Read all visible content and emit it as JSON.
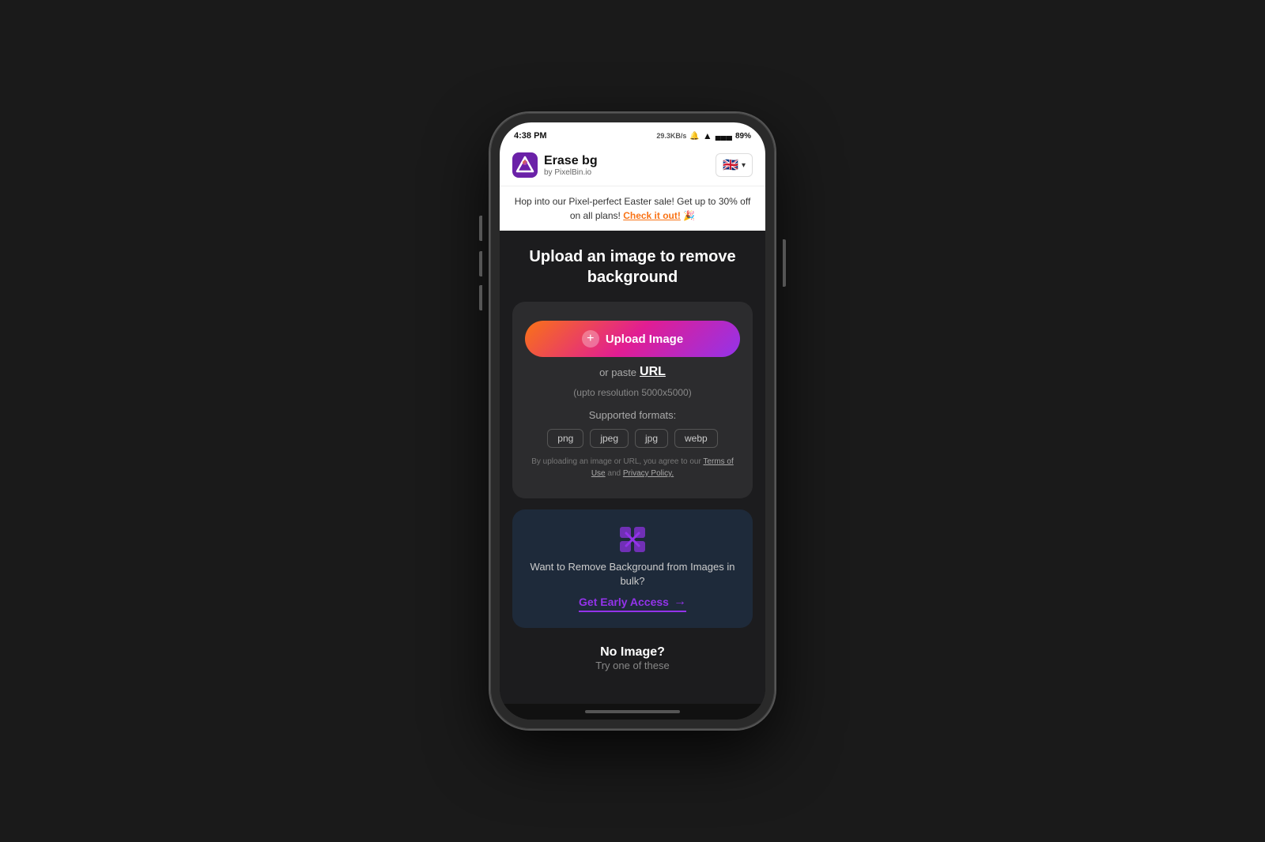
{
  "statusBar": {
    "time": "4:38 PM",
    "networkInfo": "29.3KB/s",
    "battery": "89%"
  },
  "header": {
    "appName": "Erase bg",
    "byText": "by PixelBin.io",
    "language": "EN"
  },
  "promoBanner": {
    "text": "Hop into our Pixel-perfect Easter sale! Get up to 30% off on all plans!",
    "linkText": "Check it out!",
    "emoji": "🎉"
  },
  "main": {
    "pageTitle": "Upload an image to remove background",
    "uploadButton": "Upload Image",
    "orPaste": "or paste",
    "urlLabel": "URL",
    "resolution": "(upto resolution 5000x5000)",
    "supportedTitle": "Supported formats:",
    "formats": [
      "png",
      "jpeg",
      "jpg",
      "webp"
    ],
    "termsText": "By uploading an image or URL, you agree to our",
    "termsLink": "Terms of Use",
    "andText": "and",
    "privacyLink": "Privacy Policy."
  },
  "bulkSection": {
    "text": "Want to Remove Background from Images in bulk?",
    "ctaLabel": "Get Early Access"
  },
  "noImage": {
    "title": "No Image?",
    "subtext": "Try one of these"
  }
}
